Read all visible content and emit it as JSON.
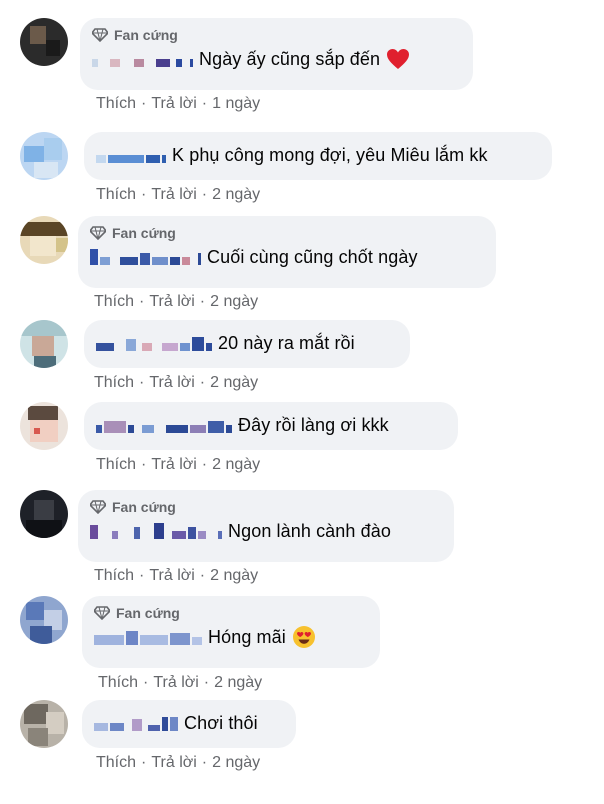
{
  "badge_label": "Fan cứng",
  "actions": {
    "like": "Thích",
    "reply": "Trả lời",
    "separator": "·"
  },
  "colors": {
    "bubble": "#f0f2f5",
    "meta": "#65676b",
    "heart": "#e0202e"
  },
  "comments": [
    {
      "badge": true,
      "text": "Ngày ấy cũng sắp đến",
      "emoji": "red-heart-icon",
      "time": "1 ngày"
    },
    {
      "badge": false,
      "text": "K phụ công mong đợi, yêu Miêu lắm kk",
      "time": "2 ngày"
    },
    {
      "badge": true,
      "text": "Cuối cùng cũng chốt ngày",
      "time": "2 ngày"
    },
    {
      "badge": false,
      "text": "20 này ra mắt rồi",
      "time": "2 ngày"
    },
    {
      "badge": false,
      "text": "Đây rồi làng ơi kkk",
      "time": "2 ngày"
    },
    {
      "badge": true,
      "text": "Ngon lành cành đào",
      "time": "2 ngày"
    },
    {
      "badge": true,
      "text": "Hóng mãi",
      "emoji": "heart-eyes-emoji-icon",
      "time": "2 ngày"
    },
    {
      "badge": false,
      "text": "Chơi thôi",
      "time": "2 ngày"
    }
  ]
}
